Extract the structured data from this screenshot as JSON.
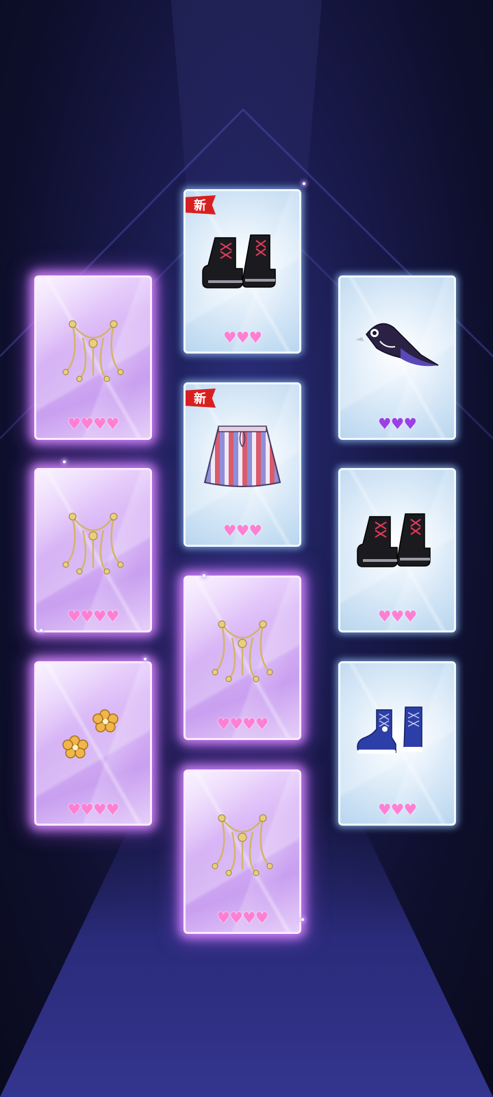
{
  "new_badge_label": "新",
  "colors": {
    "heart_pink": "#ff7fd2",
    "heart_violet": "#9b3fe6",
    "purple_card_glow": "#d88cff",
    "new_badge": "#d81f1f"
  },
  "cards": [
    {
      "id": "c1",
      "rarity": "purple",
      "item": "gold-chain-necklace",
      "hearts": "♥♥♥♥",
      "heart_color": "pink",
      "new": false
    },
    {
      "id": "c2",
      "rarity": "blue",
      "item": "black-platform-boots",
      "hearts": "♥♥♥",
      "heart_color": "pink",
      "new": true
    },
    {
      "id": "c3",
      "rarity": "blue",
      "item": "crow-hair-accessory",
      "hearts": "♥♥♥",
      "heart_color": "violet",
      "new": false
    },
    {
      "id": "c4",
      "rarity": "blue",
      "item": "striped-skirt",
      "hearts": "♥♥♥",
      "heart_color": "pink",
      "new": true
    },
    {
      "id": "c5",
      "rarity": "purple",
      "item": "gold-chain-necklace",
      "hearts": "♥♥♥♥",
      "heart_color": "pink",
      "new": false
    },
    {
      "id": "c6",
      "rarity": "blue",
      "item": "black-platform-boots",
      "hearts": "♥♥♥",
      "heart_color": "pink",
      "new": false
    },
    {
      "id": "c7",
      "rarity": "purple",
      "item": "gold-chain-necklace",
      "hearts": "♥♥♥♥",
      "heart_color": "pink",
      "new": false
    },
    {
      "id": "c8",
      "rarity": "purple",
      "item": "gold-flower-earrings",
      "hearts": "♥♥♥♥",
      "heart_color": "pink",
      "new": false
    },
    {
      "id": "c9",
      "rarity": "blue",
      "item": "blue-high-top-sneakers",
      "hearts": "♥♥♥",
      "heart_color": "pink",
      "new": false
    },
    {
      "id": "c10",
      "rarity": "purple",
      "item": "gold-chain-necklace",
      "hearts": "♥♥♥♥",
      "heart_color": "pink",
      "new": false
    }
  ]
}
